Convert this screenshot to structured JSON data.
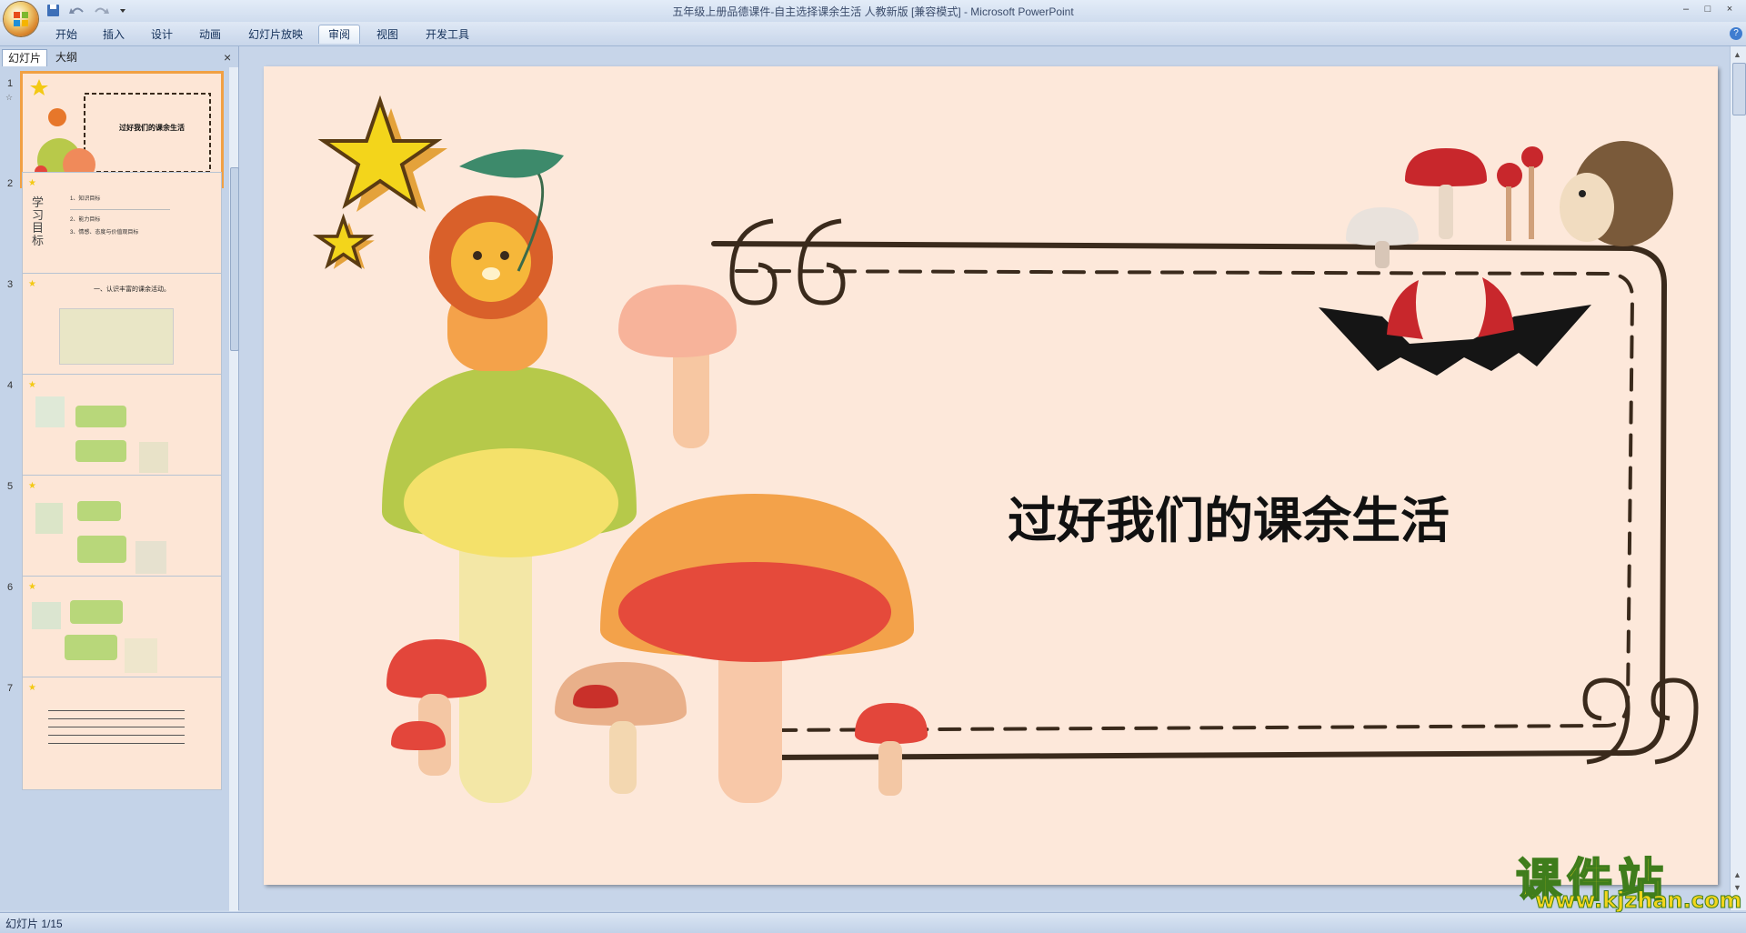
{
  "window": {
    "title": "五年级上册品德课件-自主选择课余生活 人教新版 [兼容模式] - Microsoft PowerPoint",
    "buttons": [
      "–",
      "□",
      "×"
    ]
  },
  "ribbon": {
    "tabs": [
      "开始",
      "插入",
      "设计",
      "动画",
      "幻灯片放映",
      "审阅",
      "视图",
      "开发工具"
    ],
    "active_tab": "审阅",
    "help": "?"
  },
  "left_pane": {
    "tabs": [
      "幻灯片",
      "大纲"
    ],
    "close": "×",
    "slides": [
      {
        "num": "1",
        "text": "过好我们的课余生活"
      },
      {
        "num": "2",
        "title": "学习目标",
        "lines": [
          "1、知识目标",
          "2、能力目标",
          "3、情感、态度与价值观目标"
        ]
      },
      {
        "num": "3",
        "text": "一、认识丰富的课余活动。"
      },
      {
        "num": "4",
        "text": ""
      },
      {
        "num": "5",
        "text": ""
      },
      {
        "num": "6",
        "text": ""
      },
      {
        "num": "7",
        "text": ""
      }
    ]
  },
  "slide": {
    "title": "过好我们的课余生活"
  },
  "status": {
    "slide_indicator": "幻灯片 1/15"
  },
  "watermark": {
    "line1": "课件站",
    "line2": "www.kjzhan.com"
  },
  "colors": {
    "slide_bg": "#fde8da",
    "frame": "#3a2a1c",
    "mushroom_red": "#e3463b",
    "mushroom_yellow": "#e9d55a",
    "lion": "#f08a2a"
  }
}
